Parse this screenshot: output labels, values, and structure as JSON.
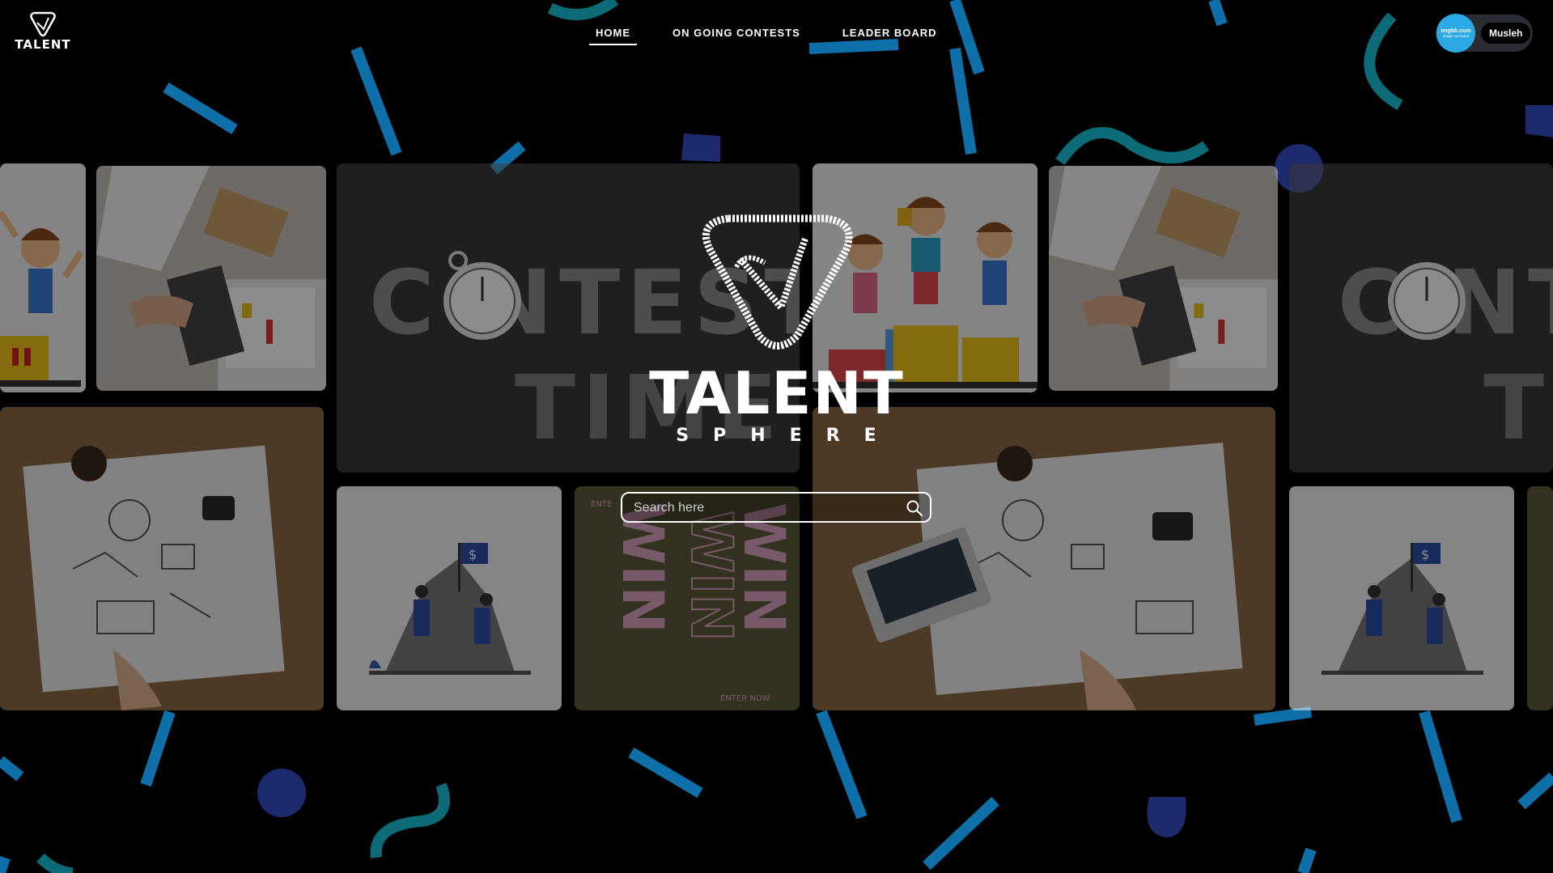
{
  "app": {
    "logo_text": "TALENT",
    "hero_title": "TALENT",
    "hero_subtitle": "SPHERE"
  },
  "nav": {
    "items": [
      {
        "label": "HOME",
        "active": true
      },
      {
        "label": "ON GOING CONTESTS",
        "active": false
      },
      {
        "label": "LEADER BOARD",
        "active": false
      }
    ]
  },
  "user": {
    "name": "Musleh",
    "avatar_text_1": "imgbb.com",
    "avatar_text_2": "image not found",
    "avatar_color": "#2ba9e4"
  },
  "search": {
    "placeholder": "Search here",
    "icon": "search-icon"
  },
  "tiles": [
    {
      "name": "tile-kids-podium-edge",
      "theme": "kids-podium"
    },
    {
      "name": "tile-desk-laptop",
      "theme": "desk"
    },
    {
      "name": "tile-contest-time",
      "theme": "contest-time"
    },
    {
      "name": "tile-kids-podium",
      "theme": "kids-podium"
    },
    {
      "name": "tile-desk-laptop-2",
      "theme": "desk"
    },
    {
      "name": "tile-contest-time-2",
      "theme": "contest-time"
    },
    {
      "name": "tile-sketch-desk",
      "theme": "sketch-desk"
    },
    {
      "name": "tile-mountain-climb",
      "theme": "mountain"
    },
    {
      "name": "tile-win-poster",
      "theme": "win"
    },
    {
      "name": "tile-sketch-desk-2",
      "theme": "sketch-desk"
    },
    {
      "name": "tile-mountain-climb-2",
      "theme": "mountain"
    }
  ],
  "colors": {
    "background": "#000000",
    "confetti_blue": "#0f6fa8",
    "confetti_teal": "#0d6b78",
    "confetti_navy": "#1e2a6e"
  }
}
